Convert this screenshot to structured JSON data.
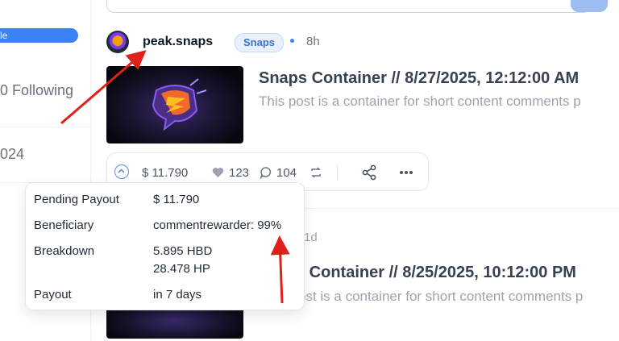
{
  "sidebar": {
    "pill_label": "le",
    "following_text": "0 Following",
    "year_text": "024"
  },
  "post1": {
    "author": "peak.snaps",
    "community_tag": "Snaps",
    "time": "8h",
    "title": "Snaps Container // 8/27/2025, 12:12:00 AM",
    "excerpt": "This post is a container for short content comments p",
    "payout": "$ 11.790",
    "votes": "123",
    "comments": "104"
  },
  "post2": {
    "time": "1d",
    "title": "s Container // 8/25/2025, 10:12:00 PM",
    "excerpt": "ost is a container for short content comments p"
  },
  "tooltip": {
    "rows": [
      {
        "label": "Pending Payout",
        "value": "$ 11.790"
      },
      {
        "label": "Beneficiary",
        "value": "commentrewarder: 99%"
      },
      {
        "label": "Breakdown",
        "value": "5.895 HBD",
        "value2": "28.478 HP"
      },
      {
        "label": "Payout",
        "value": "in 7 days"
      }
    ]
  },
  "colors": {
    "accent": "#3b82f6",
    "annotation_arrow": "#e0201b"
  },
  "icons": [
    "upvote-icon",
    "heart-icon",
    "comment-icon",
    "reblog-icon",
    "share-icon",
    "more-icon"
  ]
}
